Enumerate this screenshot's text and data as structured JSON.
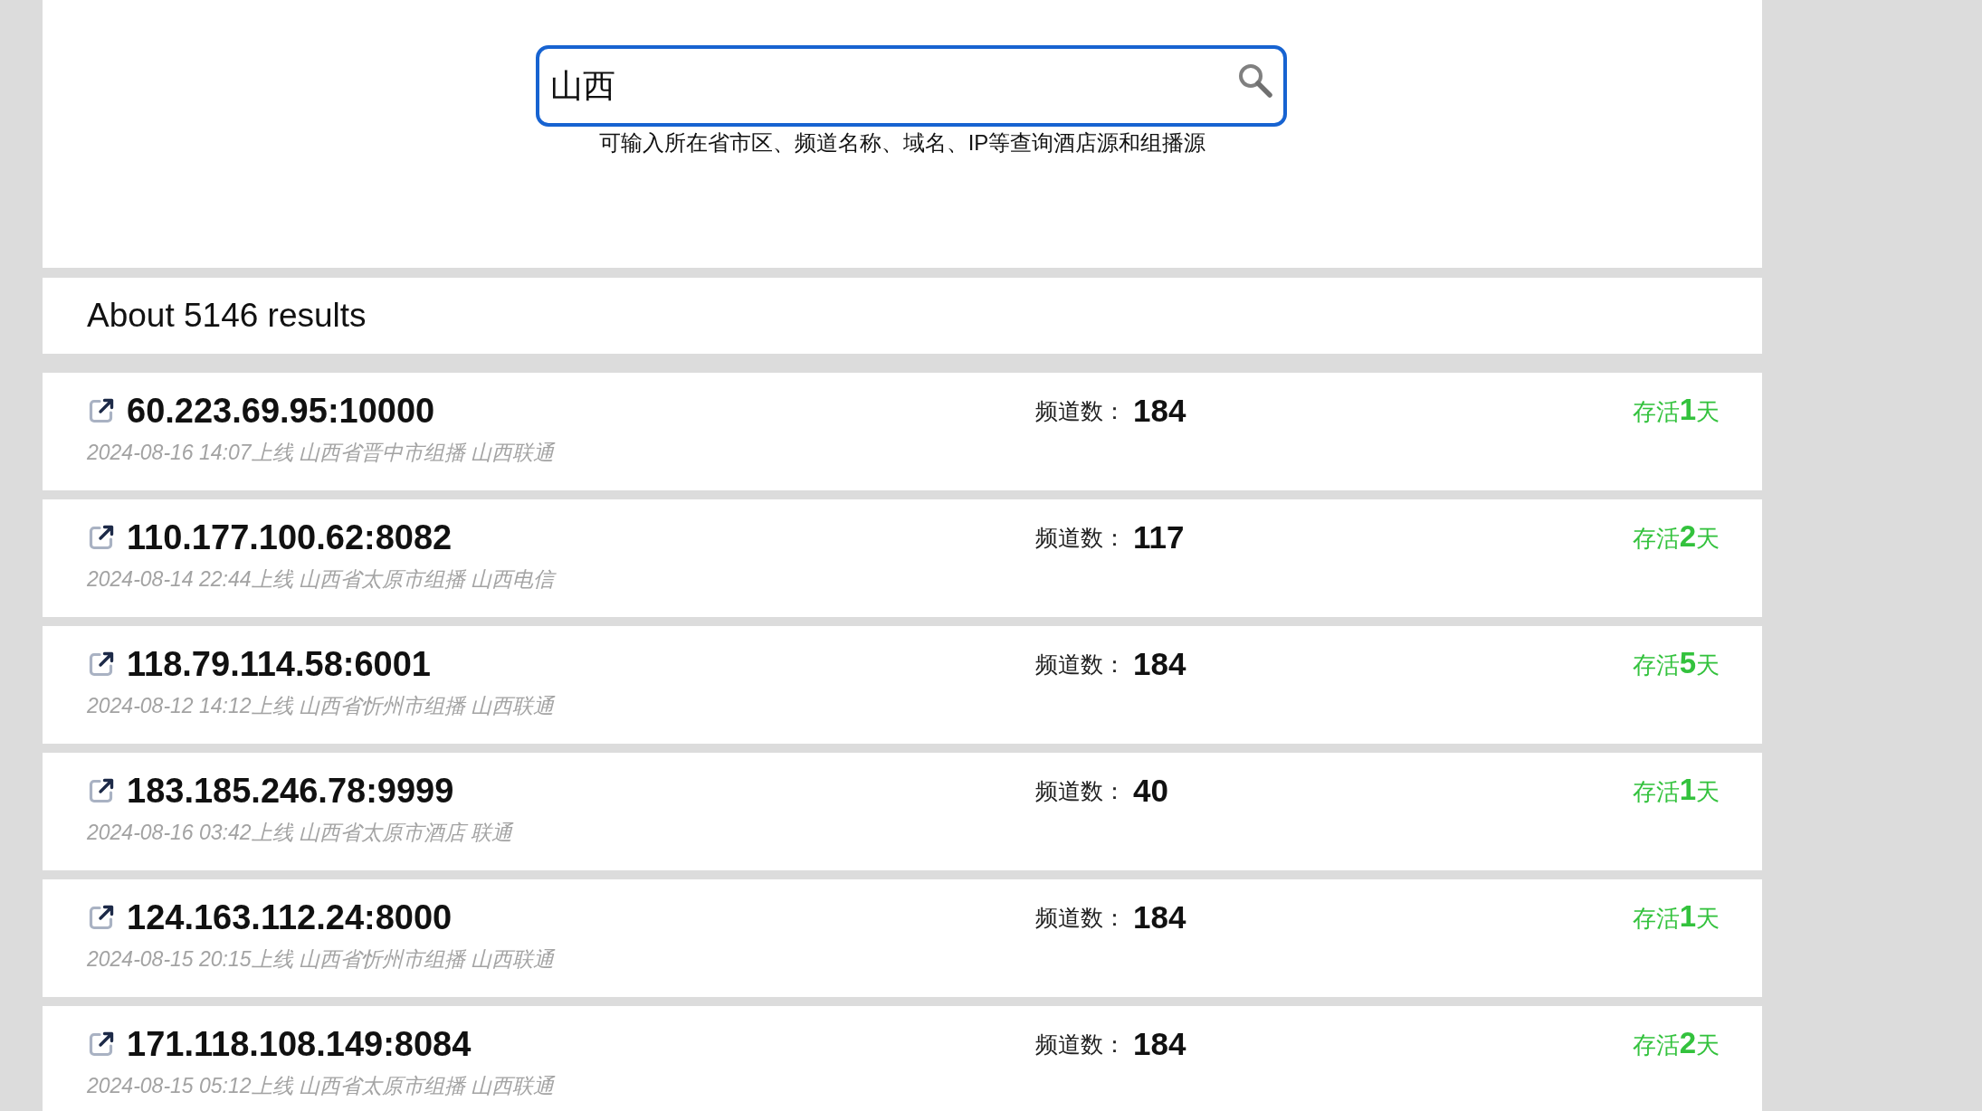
{
  "search": {
    "value": "山西",
    "focused": true,
    "hint": "可输入所在省市区、频道名称、域名、IP等查询酒店源和组播源"
  },
  "results_summary": "About 5146 results",
  "results": [
    {
      "address": "60.223.69.95:10000",
      "details": "2024-08-16 14:07上线 山西省晋中市组播 山西联通",
      "channels_label": "频道数：",
      "channels": "184",
      "alive": "存活**1**天"
    },
    {
      "address": "110.177.100.62:8082",
      "details": "2024-08-14 22:44上线 山西省太原市组播 山西电信",
      "channels_label": "频道数：",
      "channels": "117",
      "alive": "存活**2**天"
    },
    {
      "address": "118.79.114.58:6001",
      "details": "2024-08-12 14:12上线 山西省忻州市组播 山西联通",
      "channels_label": "频道数：",
      "channels": "184",
      "alive": "存活**5**天"
    },
    {
      "address": "183.185.246.78:9999",
      "details": "2024-08-16 03:42上线 山西省太原市酒店 联通",
      "channels_label": "频道数：",
      "channels": "40",
      "alive": "存活**1**天"
    },
    {
      "address": "124.163.112.24:8000",
      "details": "2024-08-15 20:15上线 山西省忻州市组播 山西联通",
      "channels_label": "频道数：",
      "channels": "184",
      "alive": "存活**1**天"
    },
    {
      "address": "171.118.108.149:8084",
      "details": "2024-08-15 05:12上线 山西省太原市组播 山西联通",
      "channels_label": "频道数：",
      "channels": "184",
      "alive": "存活**2**天"
    }
  ]
}
